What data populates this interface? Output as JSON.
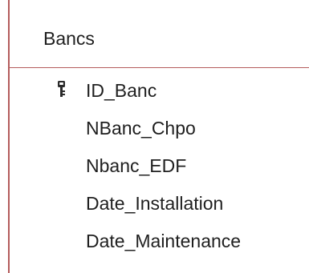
{
  "table": {
    "title": "Bancs",
    "fields": [
      {
        "name": "ID_Banc",
        "primary_key": true,
        "icon": "key-icon"
      },
      {
        "name": "NBanc_Chpo",
        "primary_key": false
      },
      {
        "name": "Nbanc_EDF",
        "primary_key": false
      },
      {
        "name": "Date_Installation",
        "primary_key": false
      },
      {
        "name": "Date_Maintenance",
        "primary_key": false
      }
    ]
  },
  "colors": {
    "border": "#b45c5c",
    "text": "#1f1f1f",
    "background": "#ffffff"
  }
}
